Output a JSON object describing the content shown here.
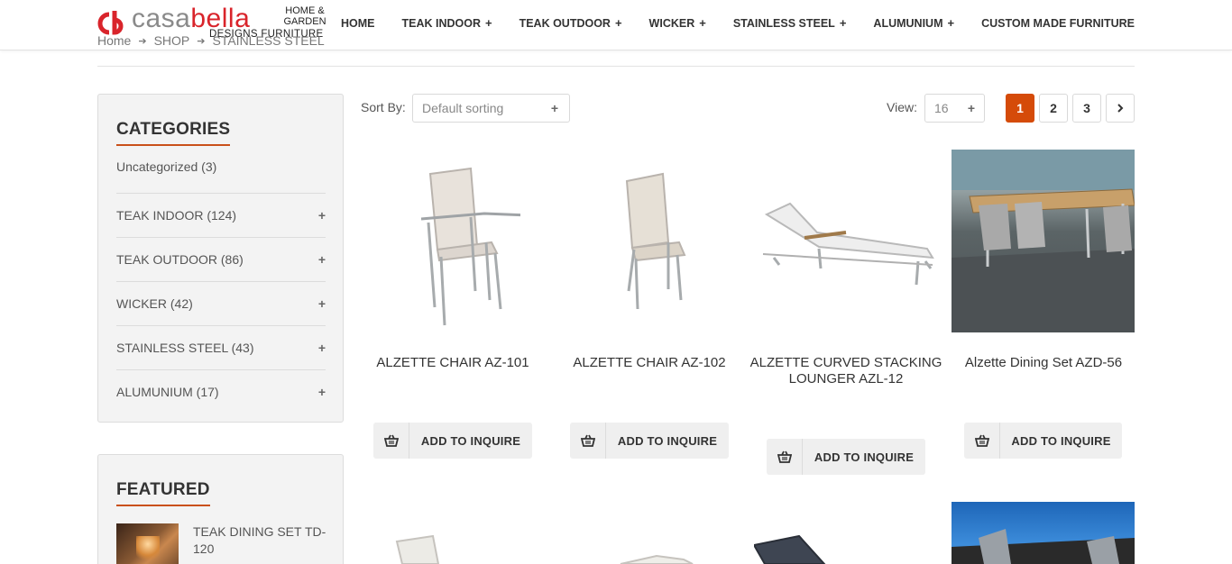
{
  "header": {
    "logo": {
      "casa": "casa",
      "bella": "bella",
      "tag": "HOME & GARDEN",
      "sub": "DESIGNS FURNITURE"
    },
    "nav": [
      {
        "label": "HOME",
        "has_sub": false
      },
      {
        "label": "TEAK INDOOR",
        "has_sub": true
      },
      {
        "label": "TEAK OUTDOOR",
        "has_sub": true
      },
      {
        "label": "WICKER",
        "has_sub": true
      },
      {
        "label": "STAINLESS STEEL",
        "has_sub": true
      },
      {
        "label": "ALUMUNIUM",
        "has_sub": true
      },
      {
        "label": "CUSTOM MADE FURNITURE",
        "has_sub": false
      }
    ],
    "plus": "+"
  },
  "breadcrumb": [
    "Home",
    "SHOP",
    "STAINLESS STEEL"
  ],
  "sidebar": {
    "categories_title": "CATEGORIES",
    "categories": [
      {
        "label": "Uncategorized (3)",
        "expandable": false
      },
      {
        "label": "TEAK INDOOR (124)",
        "expandable": true
      },
      {
        "label": "TEAK OUTDOOR (86)",
        "expandable": true
      },
      {
        "label": "WICKER (42)",
        "expandable": true
      },
      {
        "label": "STAINLESS STEEL (43)",
        "expandable": true
      },
      {
        "label": "ALUMUNIUM (17)",
        "expandable": true
      }
    ],
    "featured_title": "FEATURED",
    "featured": [
      {
        "name": "TEAK DINING SET TD-120"
      }
    ]
  },
  "toolbar": {
    "sort_label": "Sort By:",
    "sort_value": "Default sorting",
    "view_label": "View:",
    "view_value": "16",
    "pages": [
      "1",
      "2",
      "3"
    ],
    "current_page": "1"
  },
  "products": [
    {
      "name": "ALZETTE CHAIR AZ-101",
      "button": "ADD TO INQUIRE"
    },
    {
      "name": "ALZETTE CHAIR AZ-102",
      "button": "ADD TO INQUIRE"
    },
    {
      "name": "ALZETTE CURVED STACKING LOUNGER AZL-12",
      "button": "ADD TO INQUIRE"
    },
    {
      "name": "Alzette Dining Set AZD-56",
      "button": "ADD TO INQUIRE"
    }
  ],
  "colors": {
    "accent": "#d54b09",
    "brand_red": "#d9242b",
    "panel_bg": "#f3f3f3"
  }
}
